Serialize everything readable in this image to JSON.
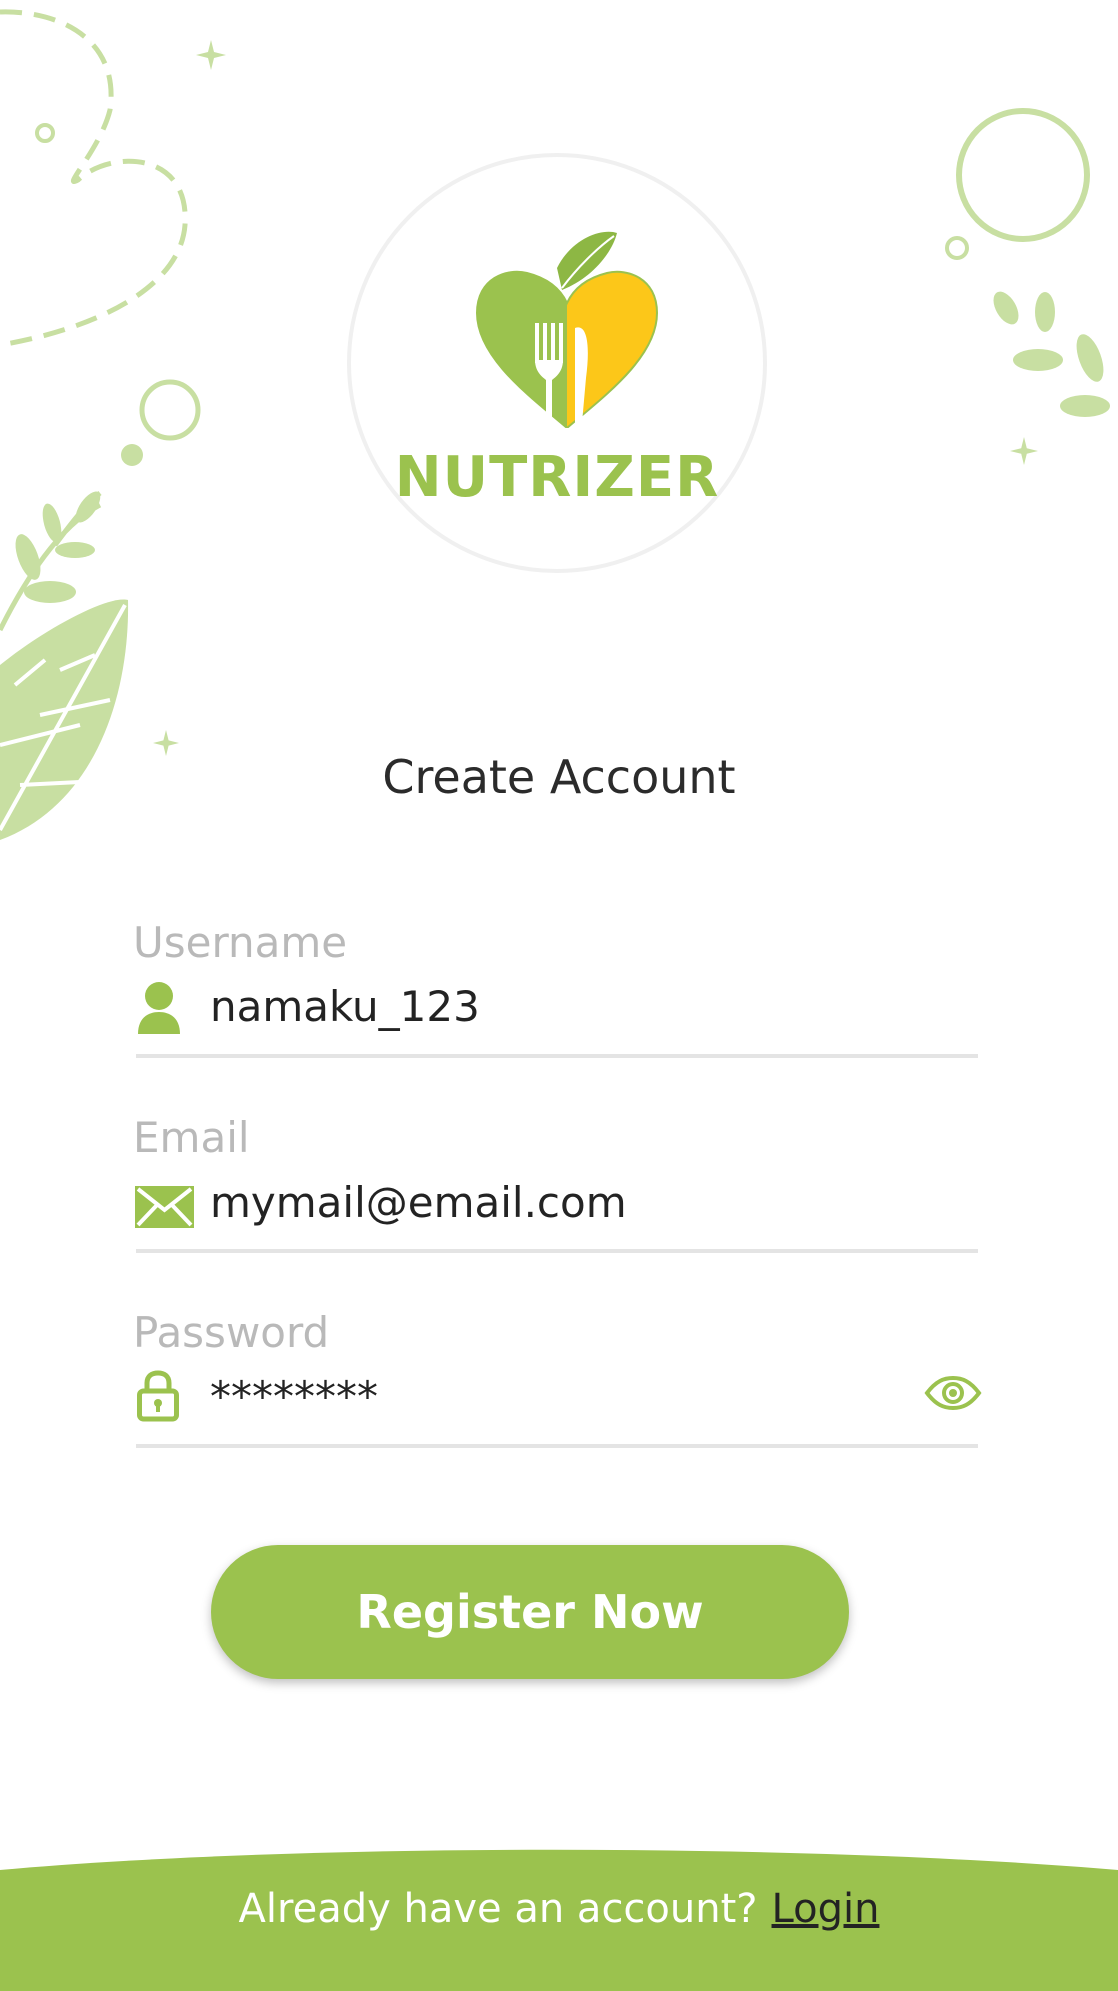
{
  "brand": {
    "name": "NUTRIZER"
  },
  "title": "Create Account",
  "form": {
    "username": {
      "label": "Username",
      "value": "namaku_123",
      "icon": "user-icon"
    },
    "email": {
      "label": "Email",
      "value": "mymail@email.com",
      "icon": "mail-icon"
    },
    "password": {
      "label": "Password",
      "value": "********",
      "icon": "lock-icon",
      "toggle_icon": "eye-icon"
    }
  },
  "register_label": "Register Now",
  "footer": {
    "prompt": "Already have an account?",
    "login_label": "Login"
  },
  "colors": {
    "accent": "#9bc24e",
    "accent_light": "#c8dfa2",
    "yellow": "#fcc719",
    "text": "#232323",
    "muted": "#b9b9b9"
  }
}
